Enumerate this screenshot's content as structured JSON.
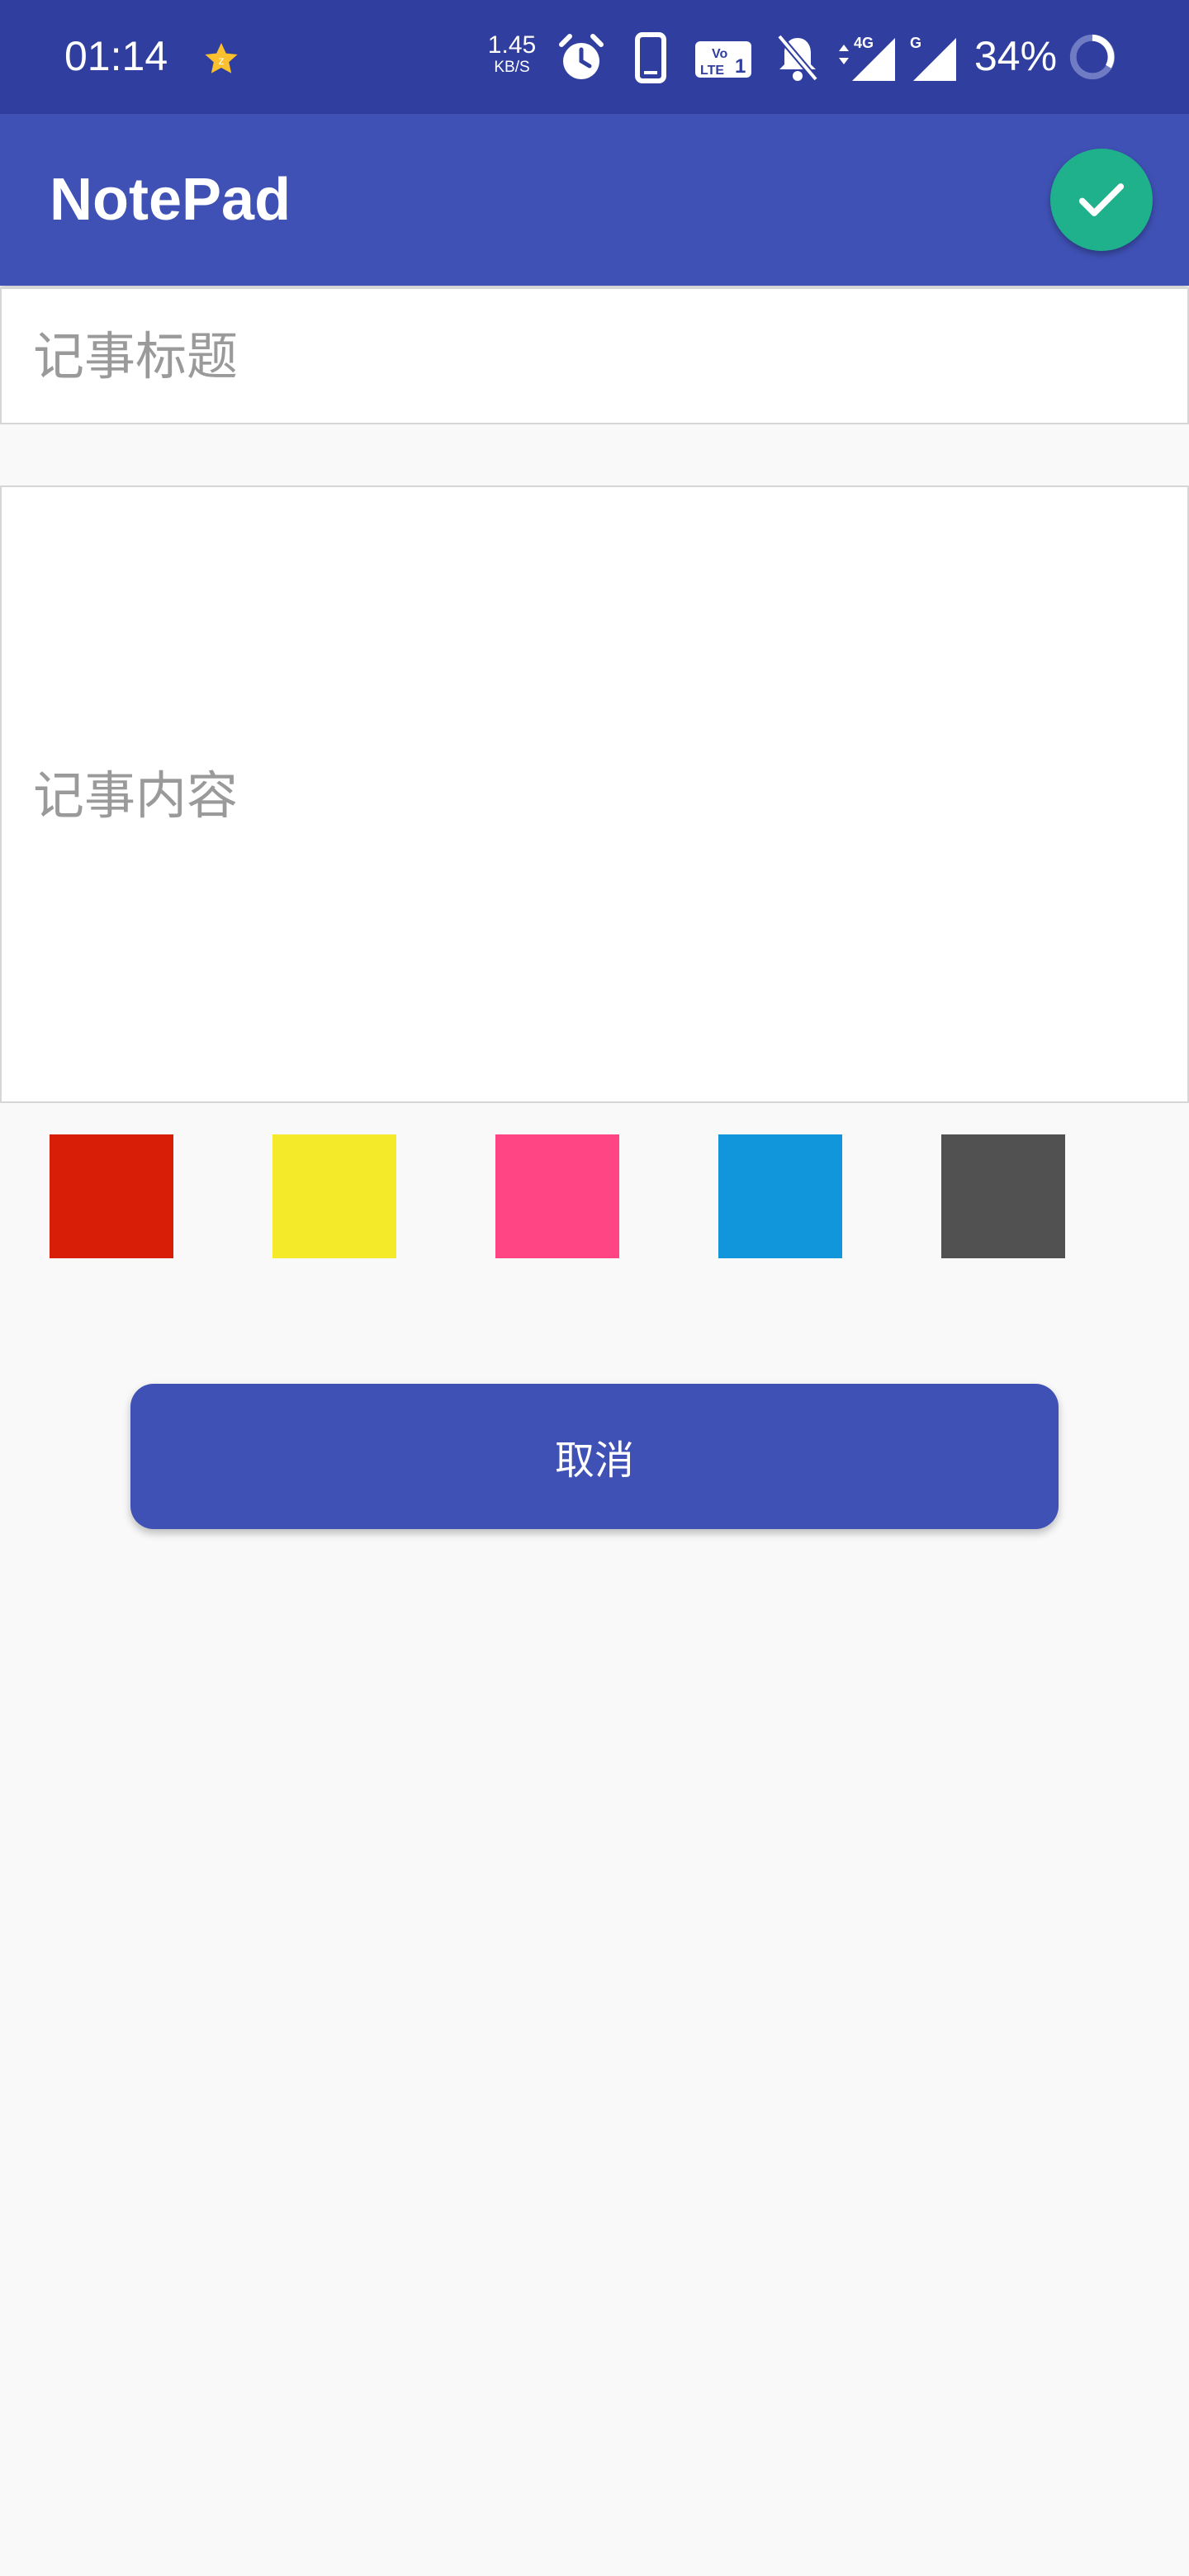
{
  "status_bar": {
    "time": "01:14",
    "network_speed_value": "1.45",
    "network_speed_unit": "KB/S",
    "volte_label": "Vo LTE 1",
    "signal_1_label": "4G",
    "signal_2_label": "G",
    "battery_percent": "34%",
    "icons": [
      "star-icon",
      "alarm-icon",
      "phone-icon",
      "volte-icon",
      "bell-off-icon",
      "signal-4g-icon",
      "signal-g-icon",
      "battery-ring-icon"
    ]
  },
  "app_bar": {
    "title": "NotePad",
    "confirm_icon": "check-icon",
    "confirm_color": "#1fb08c",
    "background_color": "#3f51b5"
  },
  "form": {
    "title_placeholder": "记事标题",
    "content_placeholder": "记事内容"
  },
  "colors": [
    {
      "name": "red",
      "hex": "#d81e06"
    },
    {
      "name": "yellow",
      "hex": "#f4ea2a"
    },
    {
      "name": "pink",
      "hex": "#ff4584"
    },
    {
      "name": "blue",
      "hex": "#1296db"
    },
    {
      "name": "gray",
      "hex": "#515151"
    }
  ],
  "buttons": {
    "cancel_label": "取消"
  }
}
